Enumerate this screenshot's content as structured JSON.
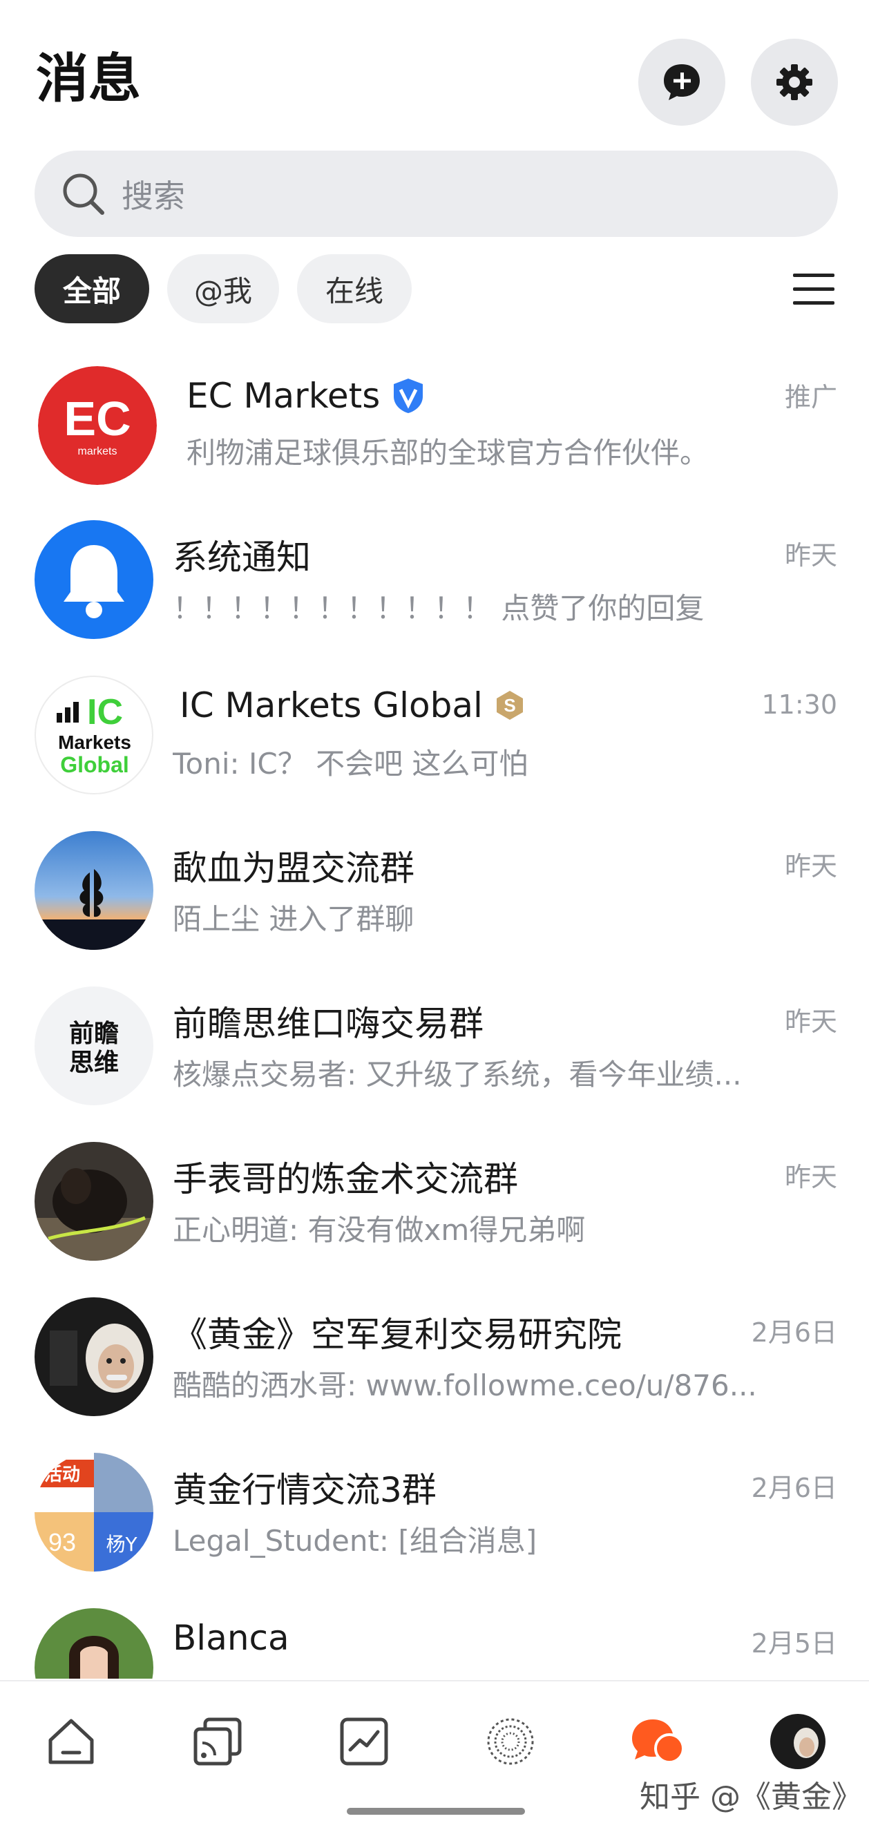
{
  "header": {
    "title": "消息"
  },
  "search": {
    "placeholder": "搜索"
  },
  "filters": [
    {
      "label": "全部",
      "active": true
    },
    {
      "label": "@我",
      "active": false
    },
    {
      "label": "在线",
      "active": false
    }
  ],
  "conversations": [
    {
      "name": "EC Markets",
      "preview": "利物浦足球俱乐部的全球官方合作伙伴。",
      "time": "推广",
      "badge": "verified-icon",
      "avatar_text": "EC",
      "avatar_sub": "markets"
    },
    {
      "name": "系统通知",
      "preview": "！！！！！！！！！！！ 点赞了你的回复",
      "time": "昨天",
      "avatar_icon": "bell-icon"
    },
    {
      "name": "IC Markets Global",
      "preview": "Toni: IC？ 不会吧 这么可怕",
      "time": "11:30",
      "badge": "gold-s-badge-icon",
      "avatar_text_lines": [
        "IC",
        "Markets",
        "Global"
      ]
    },
    {
      "name": "歃血为盟交流群",
      "preview": "陌上尘  进入了群聊",
      "time": "昨天",
      "avatar_icon": "sunset-tree-photo"
    },
    {
      "name": "前瞻思维口嗨交易群",
      "preview": "核爆点交易者: 又升级了系统，看今年业绩...",
      "time": "昨天",
      "avatar_text_lines": [
        "前瞻",
        "思维"
      ]
    },
    {
      "name": "手表哥的炼金术交流群",
      "preview": "正心明道: 有没有做xm得兄弟啊",
      "time": "昨天",
      "avatar_icon": "dog-photo"
    },
    {
      "name": "《黄金》空军复利交易研究院",
      "preview": "酷酷的洒水哥: www.followme.ceo/u/876...",
      "time": "2月6日",
      "avatar_icon": "einstein-photo"
    },
    {
      "name": "黄金行情交流3群",
      "preview": "Legal_Student: [组合消息]",
      "time": "2月6日",
      "avatar_text_lines": [
        "活动",
        "93",
        "杨Y"
      ]
    },
    {
      "name": "Blanca",
      "preview": "",
      "time": "2月5日",
      "avatar_icon": "woman-photo"
    }
  ],
  "tabbar": [
    "home-icon",
    "feed-icon",
    "chart-icon",
    "discover-icon",
    "messages-icon",
    "profile-avatar"
  ],
  "colors": {
    "accent": "#ff5a1f",
    "verified": "#2f7df6",
    "bell_bg": "#1877f2",
    "ic_green": "#3fcf3a"
  },
  "watermark": "知乎 @《黄金》"
}
